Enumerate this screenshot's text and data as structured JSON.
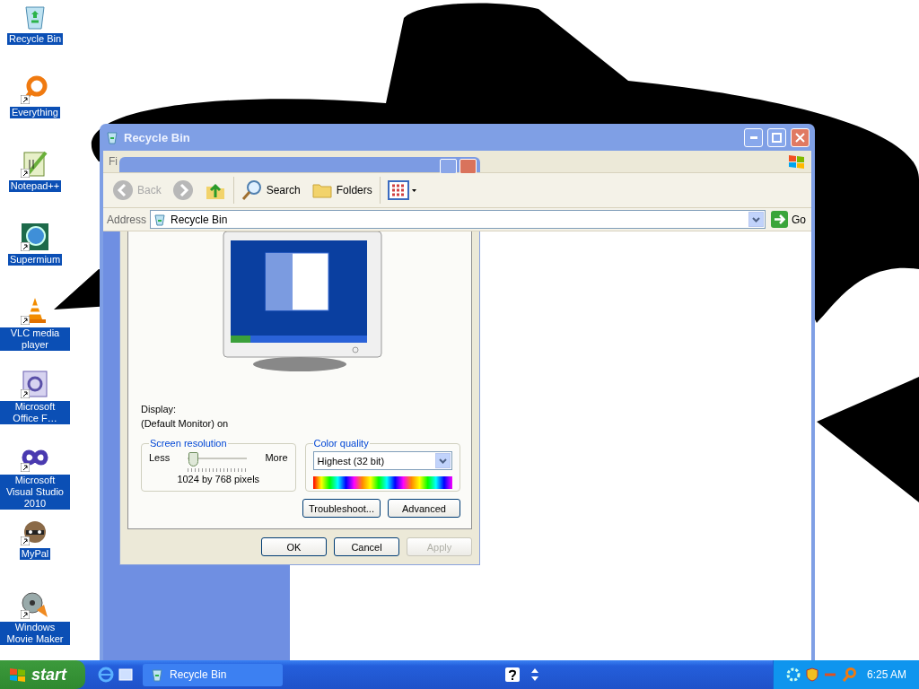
{
  "desktop": {
    "icons": [
      {
        "kind": "recycle",
        "label": "Recycle Bin",
        "shortcut": false
      },
      {
        "kind": "ring",
        "label": "Everything",
        "shortcut": true
      },
      {
        "kind": "notepad",
        "label": "Notepad++",
        "shortcut": true
      },
      {
        "kind": "globe",
        "label": "Supermium",
        "shortcut": true
      },
      {
        "kind": "cone",
        "label": "VLC media player",
        "shortcut": true
      },
      {
        "kind": "form",
        "label": "Microsoft Office F…",
        "shortcut": true
      },
      {
        "kind": "infinity",
        "label": "Microsoft Visual Studio 2010",
        "shortcut": true
      },
      {
        "kind": "raccoon",
        "label": "MyPal",
        "shortcut": true
      },
      {
        "kind": "film",
        "label": "Windows Movie Maker",
        "shortcut": true
      }
    ]
  },
  "explorer": {
    "title": "Recycle Bin",
    "menu": [
      "Fi"
    ],
    "toolbar": [
      {
        "kind": "back",
        "label": "Back",
        "disabled": true
      },
      {
        "kind": "forward",
        "disabled": true
      },
      {
        "kind": "up",
        "disabled": false
      },
      {
        "kind": "search",
        "label": "Search",
        "disabled": false
      },
      {
        "kind": "folders",
        "label": "Folders",
        "disabled": false
      },
      {
        "kind": "views",
        "disabled": false
      }
    ],
    "address": {
      "label": "Address",
      "value": "Recycle Bin",
      "go": "Go"
    }
  },
  "dialog": {
    "display_label": "Display:",
    "display_value": "(Default Monitor) on",
    "resolution": {
      "title": "Screen resolution",
      "less": "Less",
      "more": "More",
      "level": 0.08,
      "reading": "1024 by 768 pixels"
    },
    "color_quality": {
      "title": "Color quality",
      "value": "Highest (32 bit)"
    },
    "buttons": [
      {
        "label": "Troubleshoot..."
      },
      {
        "label": "Advanced"
      }
    ],
    "footer_buttons": [
      {
        "label": "OK",
        "disabled": false
      },
      {
        "label": "Cancel",
        "disabled": false
      },
      {
        "label": "Apply",
        "disabled": true
      }
    ]
  },
  "taskbar": {
    "start": "start",
    "tasks": [
      {
        "label": "Recycle Bin",
        "selected": false
      }
    ],
    "clock": "6:25 AM"
  }
}
